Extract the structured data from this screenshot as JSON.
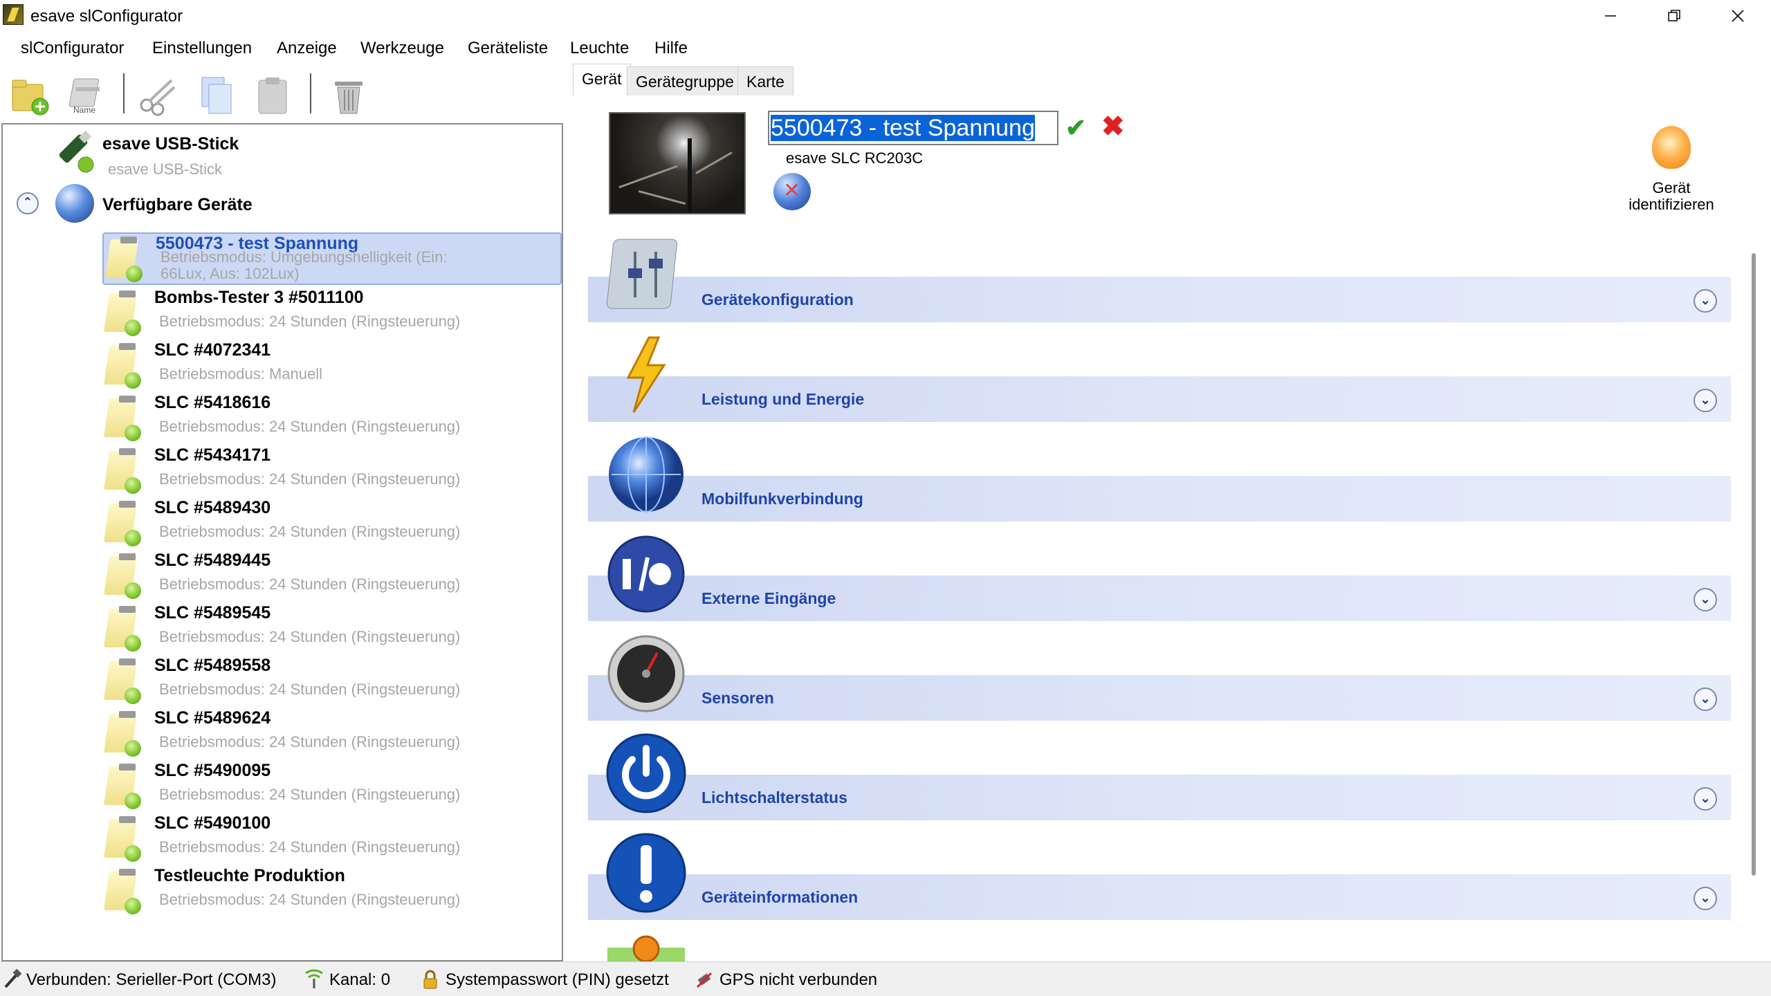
{
  "window": {
    "title": "esave slConfigurator"
  },
  "menu": [
    "slConfigurator",
    "Einstellungen",
    "Anzeige",
    "Werkzeuge",
    "Geräteliste",
    "Leuchte",
    "Hilfe"
  ],
  "toolbar": {
    "name_label": "Name"
  },
  "tree": {
    "usb": {
      "title": "esave USB-Stick",
      "subtitle": "esave USB-Stick"
    },
    "available": {
      "title": "Verfügbare Geräte"
    },
    "devices": [
      {
        "title": "5500473 - test Spannung",
        "subtitle": "Betriebsmodus: Umgebungshelligkeit (Ein: 66Lux, Aus: 102Lux)",
        "selected": true
      },
      {
        "title": "Bombs-Tester 3 #5011100",
        "subtitle": "Betriebsmodus: 24 Stunden (Ringsteuerung)"
      },
      {
        "title": "SLC #4072341",
        "subtitle": "Betriebsmodus: Manuell"
      },
      {
        "title": "SLC #5418616",
        "subtitle": "Betriebsmodus: 24 Stunden (Ringsteuerung)"
      },
      {
        "title": "SLC #5434171",
        "subtitle": "Betriebsmodus: 24 Stunden (Ringsteuerung)"
      },
      {
        "title": "SLC #5489430",
        "subtitle": "Betriebsmodus: 24 Stunden (Ringsteuerung)"
      },
      {
        "title": "SLC #5489445",
        "subtitle": "Betriebsmodus: 24 Stunden (Ringsteuerung)"
      },
      {
        "title": "SLC #5489545",
        "subtitle": "Betriebsmodus: 24 Stunden (Ringsteuerung)"
      },
      {
        "title": "SLC #5489558",
        "subtitle": "Betriebsmodus: 24 Stunden (Ringsteuerung)"
      },
      {
        "title": "SLC #5489624",
        "subtitle": "Betriebsmodus: 24 Stunden (Ringsteuerung)"
      },
      {
        "title": "SLC #5490095",
        "subtitle": "Betriebsmodus: 24 Stunden (Ringsteuerung)"
      },
      {
        "title": "SLC #5490100",
        "subtitle": "Betriebsmodus: 24 Stunden (Ringsteuerung)"
      },
      {
        "title": "Testleuchte Produktion",
        "subtitle": "Betriebsmodus: 24 Stunden (Ringsteuerung)"
      }
    ]
  },
  "tabs": [
    "Gerät",
    "Gerätegruppe",
    "Karte"
  ],
  "device": {
    "name_value": "5500473 - test Spannung",
    "model": "esave SLC RC203C",
    "identify_label": "Gerät identifizieren"
  },
  "sections": [
    {
      "label": "Gerätekonfiguration",
      "icon": "settings-sliders-icon",
      "expandable": true
    },
    {
      "label": "Leistung und Energie",
      "icon": "lightning-icon",
      "expandable": true
    },
    {
      "label": "Mobilfunkverbindung",
      "icon": "globe-icon",
      "expandable": false
    },
    {
      "label": "Externe Eingänge",
      "icon": "io-icon",
      "expandable": true
    },
    {
      "label": "Sensoren",
      "icon": "gauge-icon",
      "expandable": true
    },
    {
      "label": "Lichtschalterstatus",
      "icon": "power-icon",
      "expandable": true
    },
    {
      "label": "Geräteinformationen",
      "icon": "info-icon",
      "expandable": true
    }
  ],
  "status": {
    "connection": "Verbunden: Serieller-Port (COM3)",
    "channel": "Kanal: 0",
    "pin": "Systempasswort (PIN) gesetzt",
    "gps": "GPS nicht verbunden"
  },
  "colors": {
    "section_label": "#1f44a8",
    "selection": "#ccd8f4",
    "accent_ok": "#2aa02a",
    "accent_cancel": "#e02020"
  }
}
